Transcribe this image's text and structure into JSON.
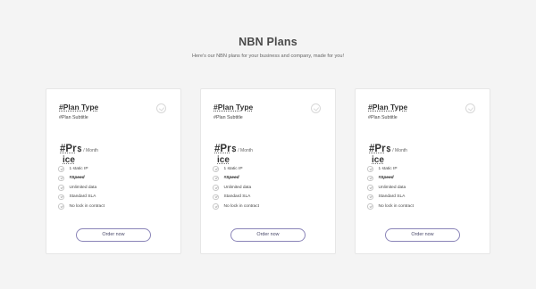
{
  "header": {
    "title": "NBN Plans",
    "subtitle": "Here's our NBN plans for your business and company, made for you!"
  },
  "plans": [
    {
      "type": "#Plan Type",
      "subtitle": "#Plan Subtitle",
      "price_main": "#Pr",
      "price_symbol": "$",
      "price_period": "/ Month",
      "price_tail": "ice",
      "features": [
        "1 static IP",
        "#Speed",
        "Unlimited data",
        "Standard SLA",
        "No lock in contract"
      ],
      "order_label": "Order now"
    },
    {
      "type": "#Plan Type",
      "subtitle": "#Plan Subtitle",
      "price_main": "#Pr",
      "price_symbol": "$",
      "price_period": "/ Month",
      "price_tail": "ice",
      "features": [
        "1 static IP",
        "#Speed",
        "Unlimited data",
        "Standard SLA",
        "No lock in contract"
      ],
      "order_label": "Order now"
    },
    {
      "type": "#Plan Type",
      "subtitle": "#Plan Subtitle",
      "price_main": "#Pr",
      "price_symbol": "$",
      "price_period": "/ Month",
      "price_tail": "ice",
      "features": [
        "1 static IP",
        "#Speed",
        "Unlimited data",
        "Standard SLA",
        "No lock in contract"
      ],
      "order_label": "Order now"
    }
  ],
  "colors": {
    "background": "#f4f4f4",
    "card": "#ffffff",
    "button_border": "#8a84b8"
  },
  "icons": {
    "select": "circle-check-icon",
    "feature": "check-circle-icon"
  }
}
